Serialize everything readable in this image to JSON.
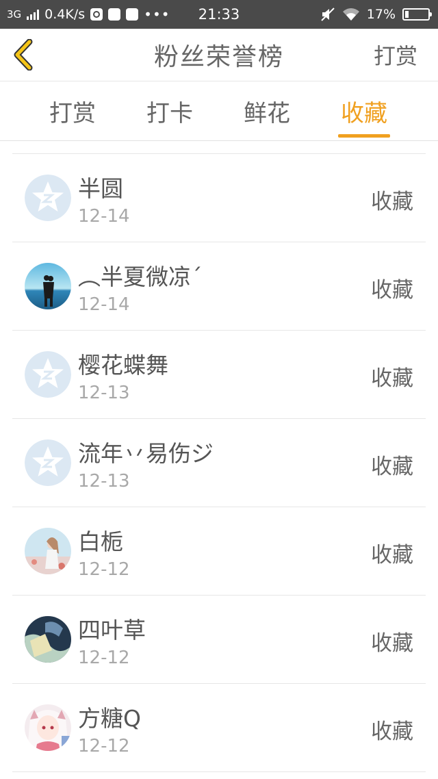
{
  "status": {
    "network": "3G",
    "speed": "0.4K/s",
    "time": "21:33",
    "battery": "17%",
    "battery_level": 0.17
  },
  "header": {
    "title": "粉丝荣誉榜",
    "right_action": "打赏",
    "back_icon": "chevron-left-icon",
    "accent": "#f0a020"
  },
  "tabs": [
    "打赏",
    "打卡",
    "鲜花",
    "收藏"
  ],
  "active_tab": 3,
  "list": [
    {
      "name": "半圆",
      "date": "12-14",
      "action": "收藏",
      "avatar": "default-star-avatar"
    },
    {
      "name": "︵半夏微凉´",
      "date": "12-14",
      "action": "收藏",
      "avatar": "couple-silhouette-avatar"
    },
    {
      "name": "樱花蝶舞",
      "date": "12-13",
      "action": "收藏",
      "avatar": "default-star-avatar"
    },
    {
      "name": "流年丷易伤ジ",
      "date": "12-13",
      "action": "收藏",
      "avatar": "default-star-avatar"
    },
    {
      "name": "白栀",
      "date": "12-12",
      "action": "收藏",
      "avatar": "girl-photo-avatar"
    },
    {
      "name": "四叶草",
      "date": "12-12",
      "action": "收藏",
      "avatar": "anime-blue-avatar"
    },
    {
      "name": "方糖Q",
      "date": "12-12",
      "action": "收藏",
      "avatar": "anime-girl-avatar"
    }
  ]
}
